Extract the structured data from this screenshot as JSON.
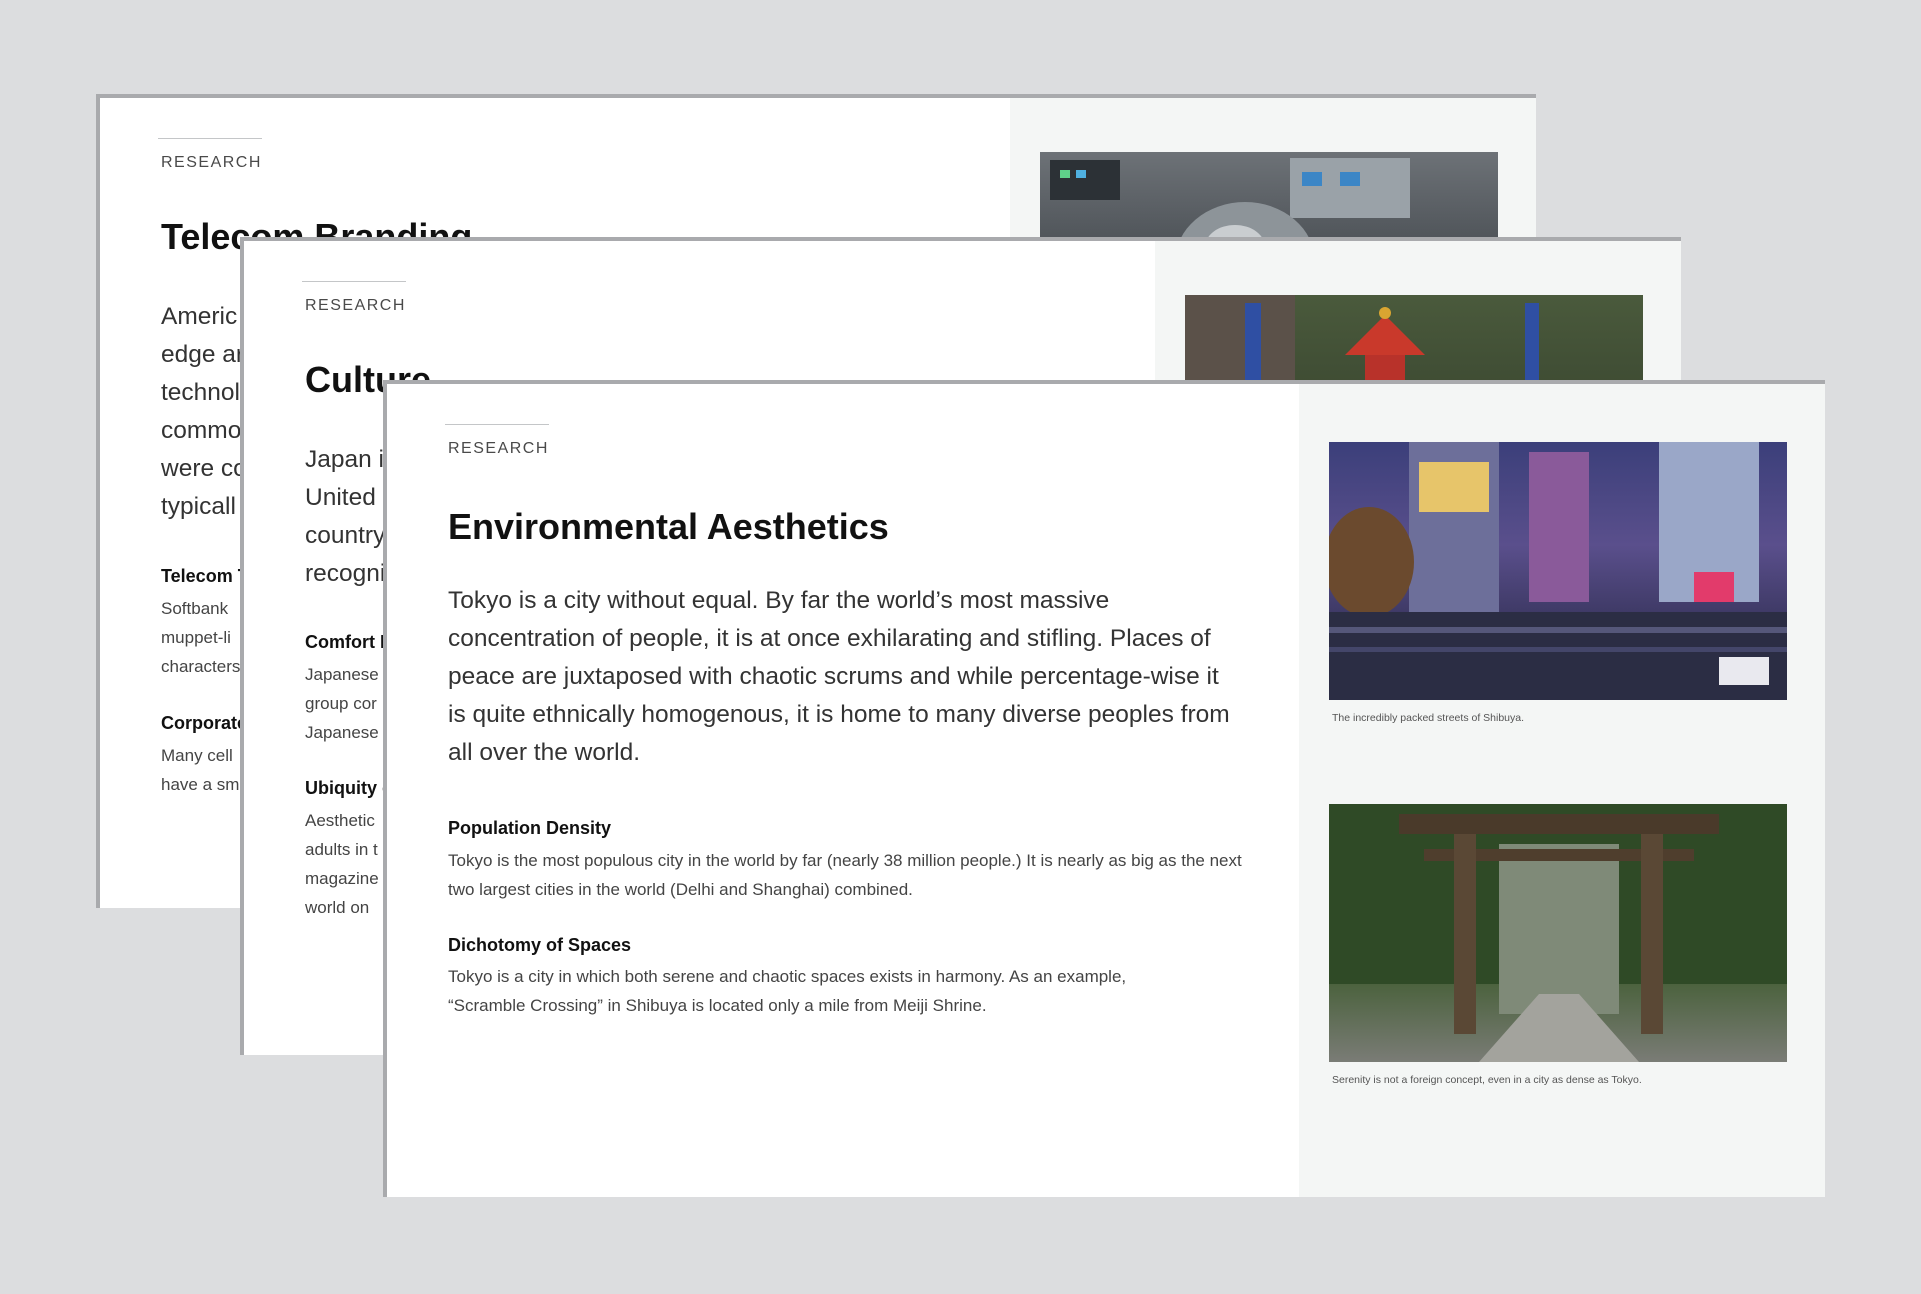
{
  "slides": {
    "back": {
      "eyebrow": "RESEARCH",
      "title": "Telecom Branding",
      "lead_lines": [
        "Americ",
        "edge ar",
        "technol",
        "commo",
        "were co",
        "typicall"
      ],
      "sections": [
        {
          "heading": "Telecom T",
          "lines": [
            "Softbank",
            "muppet-li",
            "characters"
          ]
        },
        {
          "heading": "Corporate",
          "lines": [
            "Many cell",
            "have a sm"
          ]
        }
      ]
    },
    "middle": {
      "eyebrow": "RESEARCH",
      "title": "Culture",
      "lead_lines": [
        "Japan i",
        "United",
        "country",
        "recogni"
      ],
      "sections": [
        {
          "heading": "Comfort L",
          "lines": [
            "Japanese",
            "group cor",
            "Japanese"
          ]
        },
        {
          "heading": "Ubiquity o",
          "lines": [
            "Aesthetic",
            "adults in t",
            "magazine",
            "world on"
          ]
        }
      ]
    },
    "front": {
      "eyebrow": "RESEARCH",
      "title": "Environmental Aesthetics",
      "lead": "Tokyo is a city without equal. By far the world’s most massive concentration of people, it is at once exhilarating and stifling. Places of peace are juxtaposed with chaotic scrums and while percentage-wise it is quite ethnically homogenous, it is home to many diverse peoples from all over the world.",
      "sections": [
        {
          "heading": "Population Density",
          "body": "Tokyo is the most populous city in the world by far (nearly 38 million people.) It is nearly as big as the next two largest cities in the world (Delhi and Shanghai) combined."
        },
        {
          "heading": "Dichotomy of Spaces",
          "body": "Tokyo is a city in which both serene and chaotic spaces exists in harmony. As an example, “Scramble Crossing” in Shibuya is located only a mile from Meiji Shrine."
        }
      ],
      "photos": [
        {
          "caption": "The incredibly packed streets of Shibuya."
        },
        {
          "caption": "Serenity is not a foreign concept, even in a city as dense as Tokyo."
        }
      ]
    }
  }
}
